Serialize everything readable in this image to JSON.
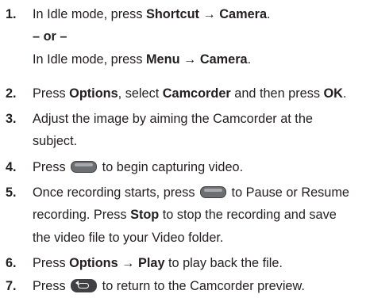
{
  "steps": [
    {
      "num": "1.",
      "parts": {
        "a": "In Idle mode, press ",
        "b": "Shortcut",
        "arrow": " → ",
        "c": "Camera",
        "d": "."
      },
      "or": "– or –",
      "alt": {
        "a": "In Idle mode, press ",
        "b": "Menu",
        "arrow": "  → ",
        "c": "Camera",
        "d": "."
      }
    },
    {
      "num": "2.",
      "parts": {
        "a": "Press ",
        "b": "Options",
        "c": ", select ",
        "d": "Camcorder",
        "e": " and then press ",
        "f": "OK",
        "g": "."
      }
    },
    {
      "num": "3.",
      "lines": [
        "Adjust the image by aiming the Camcorder at the",
        "subject."
      ]
    },
    {
      "num": "4.",
      "parts": {
        "a": "Press ",
        "b": " to begin capturing video."
      },
      "icon": "soft-key-icon"
    },
    {
      "num": "5.",
      "parts": {
        "a": "Once recording starts, press ",
        "b": " to Pause or Resume",
        "c": "recording. Press ",
        "d": "Stop",
        "e": " to stop the recording and save",
        "f": "the video file to your Video folder."
      },
      "icon": "soft-key-icon"
    },
    {
      "num": "6.",
      "parts": {
        "a": "Press ",
        "b": "Options",
        "arrow": " → ",
        "c": "Play",
        "d": " to play back the file."
      }
    },
    {
      "num": "7.",
      "parts": {
        "a": "Press ",
        "b": " to return to the Camcorder preview."
      },
      "icon": "back-key-icon"
    }
  ]
}
